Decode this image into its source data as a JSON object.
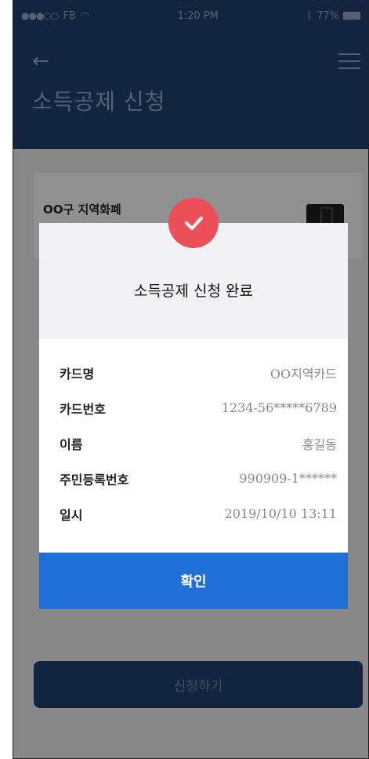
{
  "status_bar": {
    "carrier": "FB",
    "time": "1:20 PM",
    "battery": "77%"
  },
  "header": {
    "title": "소득공제 신청"
  },
  "card": {
    "name": "OO구 지역화폐"
  },
  "submit": {
    "label": "신청하기"
  },
  "modal": {
    "title": "소득공제 신청 완료",
    "rows": [
      {
        "label": "카드명",
        "value": "OO지역카드"
      },
      {
        "label": "카드번호",
        "value": "1234-56*****6789"
      },
      {
        "label": "이름",
        "value": "홍길동"
      },
      {
        "label": "주민등록번호",
        "value": "990909-1******"
      },
      {
        "label": "일시",
        "value": "2019/10/10 13:11"
      }
    ],
    "confirm_label": "확인"
  },
  "colors": {
    "header": "#1e3a66",
    "check": "#eb4f58",
    "confirm": "#1f6fd6"
  },
  "icons": [
    "back-arrow-icon",
    "hamburger-menu-icon",
    "checkmark-icon",
    "wifi-icon",
    "battery-icon",
    "bluetooth-icon"
  ]
}
